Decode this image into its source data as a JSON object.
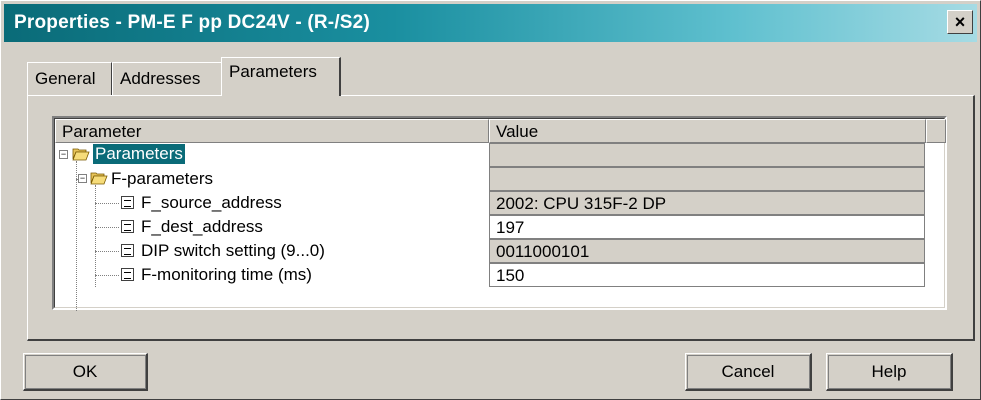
{
  "window": {
    "title": "Properties - PM-E F pp DC24V - (R-/S2)",
    "close_label": "×"
  },
  "tabs": [
    {
      "label": "General",
      "active": false
    },
    {
      "label": "Addresses",
      "active": false
    },
    {
      "label": "Parameters",
      "active": true
    }
  ],
  "grid": {
    "columns": [
      "Parameter",
      "Value"
    ],
    "rows": [
      {
        "name": "Parameters",
        "value": "",
        "kind": "folder",
        "selected": true,
        "expander": "−",
        "value_style": "gray"
      },
      {
        "name": "F-parameters",
        "value": "",
        "kind": "folder",
        "selected": false,
        "expander": "−",
        "value_style": "gray"
      },
      {
        "name": "F_source_address",
        "value": "2002: CPU 315F-2 DP",
        "kind": "leaf",
        "value_style": "gray"
      },
      {
        "name": "F_dest_address",
        "value": "197",
        "kind": "leaf",
        "value_style": "white"
      },
      {
        "name": "DIP switch setting (9...0)",
        "value": "0011000101",
        "kind": "leaf",
        "value_style": "gray"
      },
      {
        "name": "F-monitoring time (ms)",
        "value": "150",
        "kind": "leaf",
        "value_style": "white"
      }
    ]
  },
  "buttons": {
    "ok": "OK",
    "cancel": "Cancel",
    "help": "Help"
  },
  "colors": {
    "selection": "#0a6b78",
    "dialog_bg": "#d4d0c8"
  }
}
